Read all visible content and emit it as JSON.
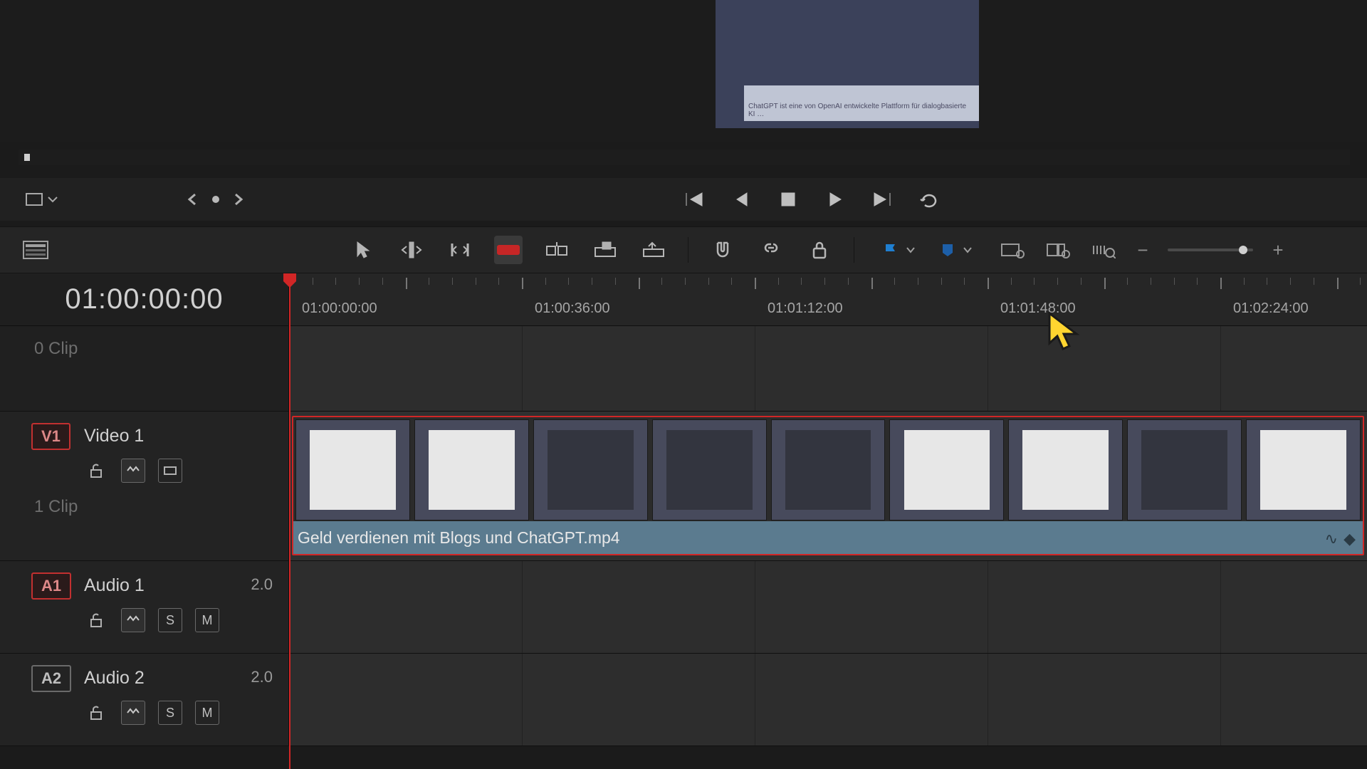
{
  "preview": {
    "caption": "ChatGPT ist eine von OpenAI entwickelte Plattform für dialogbasierte KI …"
  },
  "timecode": "01:00:00:00",
  "ruler": {
    "labels": [
      "01:00:00:00",
      "01:00:36:00",
      "01:01:12:00",
      "01:01:48:00",
      "01:02:24:00"
    ]
  },
  "subclip_row": {
    "label": "0 Clip"
  },
  "tracks": {
    "v1": {
      "tag": "V1",
      "name": "Video 1",
      "clip_count": "1 Clip"
    },
    "a1": {
      "tag": "A1",
      "name": "Audio 1",
      "channels": "2.0",
      "solo": "S",
      "mute": "M"
    },
    "a2": {
      "tag": "A2",
      "name": "Audio 2",
      "channels": "2.0",
      "solo": "S",
      "mute": "M"
    }
  },
  "clip": {
    "filename": "Geld verdienen mit Blogs und ChatGPT.mp4"
  },
  "colors": {
    "playhead": "#d12626",
    "flag_blue": "#1f7fd1",
    "flag_navy": "#1d5fa8",
    "razor": "#c62626"
  },
  "icons": {
    "transform": "transform-icon",
    "prev_clip": "chevron-left-icon",
    "dot": "dot-icon",
    "next_clip": "chevron-right-icon",
    "skip_back": "skip-back-icon",
    "step_back": "step-back-icon",
    "stop": "stop-icon",
    "play": "play-icon",
    "skip_fwd": "skip-forward-icon",
    "loop": "loop-icon",
    "timeline_view": "timeline-view-icon",
    "pointer": "pointer-icon",
    "trim": "trim-icon",
    "dynamic_trim": "dynamic-trim-icon",
    "razor": "razor-icon",
    "insert": "insert-icon",
    "overwrite": "overwrite-icon",
    "replace": "replace-icon",
    "snap": "snap-magnet-icon",
    "link": "link-icon",
    "lock": "lock-icon",
    "flag": "flag-icon",
    "marker": "marker-icon",
    "zoom_fit": "zoom-fit-icon",
    "zoom_detail": "zoom-detail-icon",
    "zoom_custom": "zoom-custom-icon",
    "arrow_cursor": "cursor-arrow-icon"
  }
}
